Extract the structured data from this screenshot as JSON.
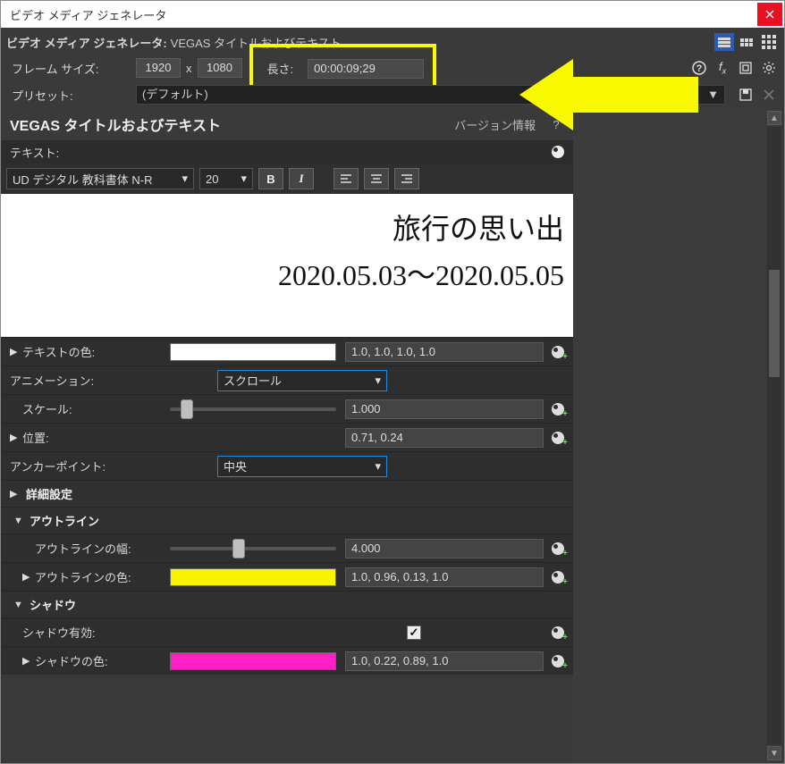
{
  "window": {
    "title": "ビデオ メディア ジェネレータ"
  },
  "header": {
    "label": "ビデオ メディア ジェネレータ:",
    "subtitle": "VEGAS タイトルおよびテキスト",
    "frame_size_label": "フレーム サイズ:",
    "width": "1920",
    "x": "x",
    "height": "1080",
    "length_label": "長さ:",
    "length_value": "00:00:09;29",
    "preset_label": "プリセット:",
    "preset_value": "(デフォルト)"
  },
  "panel": {
    "title": "VEGAS タイトルおよびテキスト",
    "version_link": "バージョン情報",
    "help": "?"
  },
  "text_section": {
    "label": "テキスト:"
  },
  "format": {
    "font": "UD デジタル 教科書体 N-R",
    "size": "20",
    "bold": "B",
    "italic": "I"
  },
  "canvas": {
    "line1": "旅行の思い出",
    "line2": "2020.05.03〜2020.05.05"
  },
  "props": {
    "text_color_label": "テキストの色:",
    "text_color_val": "1.0, 1.0, 1.0, 1.0",
    "animation_label": "アニメーション:",
    "animation_val": "スクロール",
    "scale_label": "スケール:",
    "scale_val": "1.000",
    "position_label": "位置:",
    "position_val": "0.71, 0.24",
    "anchor_label": "アンカーポイント:",
    "anchor_val": "中央",
    "advanced_label": "詳細設定",
    "outline_label": "アウトライン",
    "outline_width_label": "アウトラインの幅:",
    "outline_width_val": "4.000",
    "outline_color_label": "アウトラインの色:",
    "outline_color_val": "1.0, 0.96, 0.13, 1.0",
    "shadow_label": "シャドウ",
    "shadow_enable_label": "シャドウ有効:",
    "shadow_color_label": "シャドウの色:",
    "shadow_color_val": "1.0, 0.22, 0.89, 1.0"
  },
  "colors": {
    "highlight": "#f9f900"
  }
}
